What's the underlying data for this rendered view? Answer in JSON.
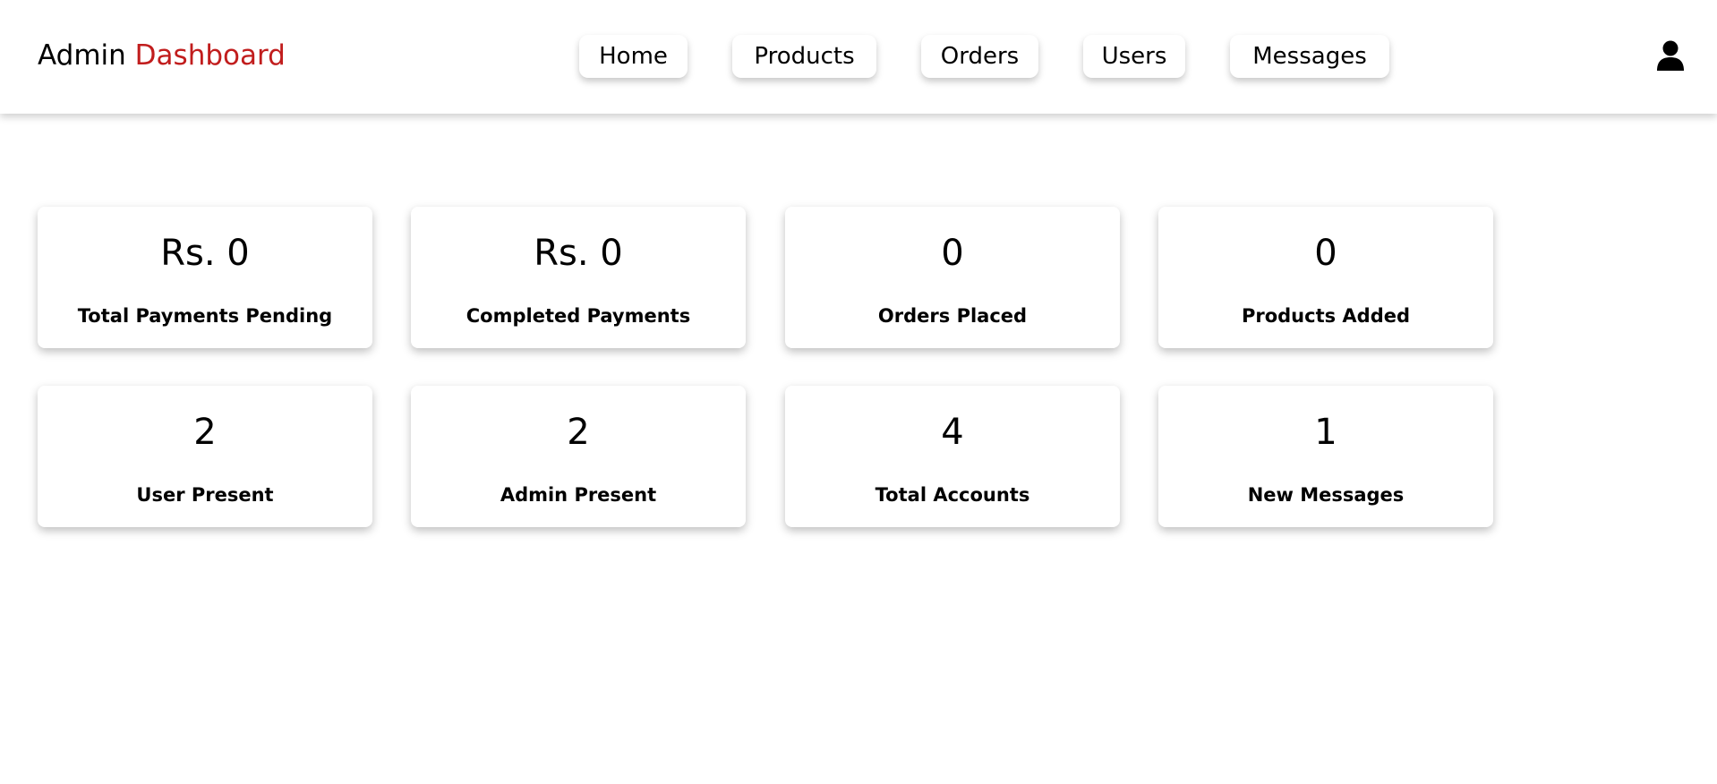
{
  "header": {
    "title_main": "Admin",
    "title_accent": "Dashboard",
    "accent_color": "#c11d1d",
    "user_icon": "user-icon"
  },
  "nav": {
    "items": [
      {
        "label": "Home"
      },
      {
        "label": "Products"
      },
      {
        "label": "Orders"
      },
      {
        "label": "Users"
      },
      {
        "label": "Messages"
      }
    ]
  },
  "stats": [
    {
      "value": "Rs. 0",
      "label": "Total Payments Pending"
    },
    {
      "value": "Rs. 0",
      "label": "Completed Payments"
    },
    {
      "value": "0",
      "label": "Orders Placed"
    },
    {
      "value": "0",
      "label": "Products Added"
    },
    {
      "value": "2",
      "label": "User Present"
    },
    {
      "value": "2",
      "label": "Admin Present"
    },
    {
      "value": "4",
      "label": "Total Accounts"
    },
    {
      "value": "1",
      "label": "New Messages"
    }
  ]
}
